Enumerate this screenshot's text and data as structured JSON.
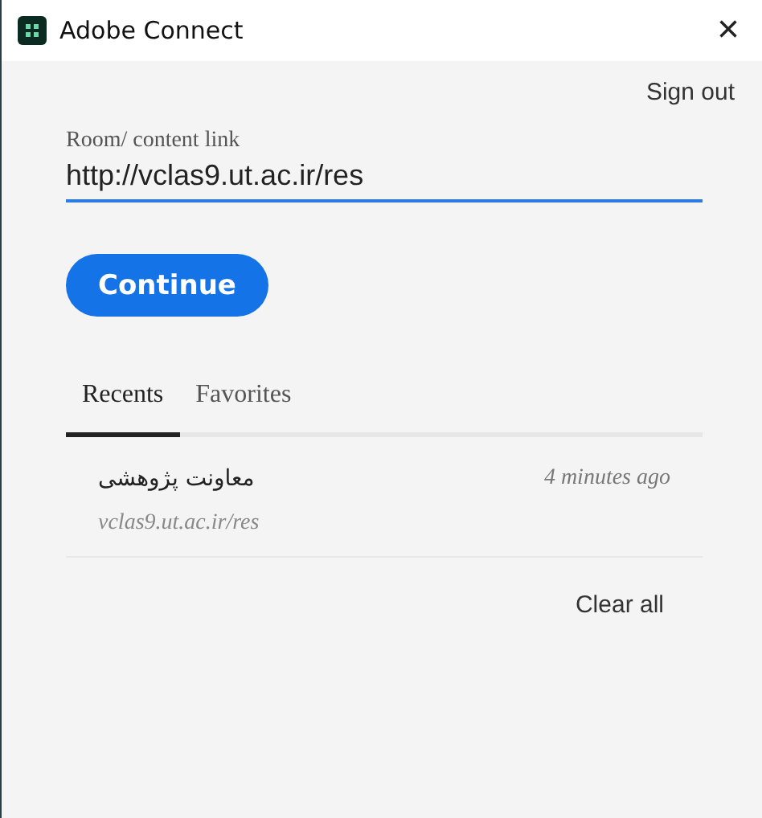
{
  "window": {
    "title": "Adobe Connect",
    "close": "×"
  },
  "sign_out": "Sign out",
  "link_field": {
    "label": "Room/ content link",
    "value": "http://vclas9.ut.ac.ir/res"
  },
  "continue_button": "Continue",
  "tabs": [
    {
      "label": "Recents",
      "selected": true
    },
    {
      "label": "Favorites",
      "selected": false
    }
  ],
  "recents": [
    {
      "name": "معاونت پژوهشی",
      "time": "4 minutes ago",
      "url": "vclas9.ut.ac.ir/res"
    }
  ],
  "clear_all": "Clear all"
}
